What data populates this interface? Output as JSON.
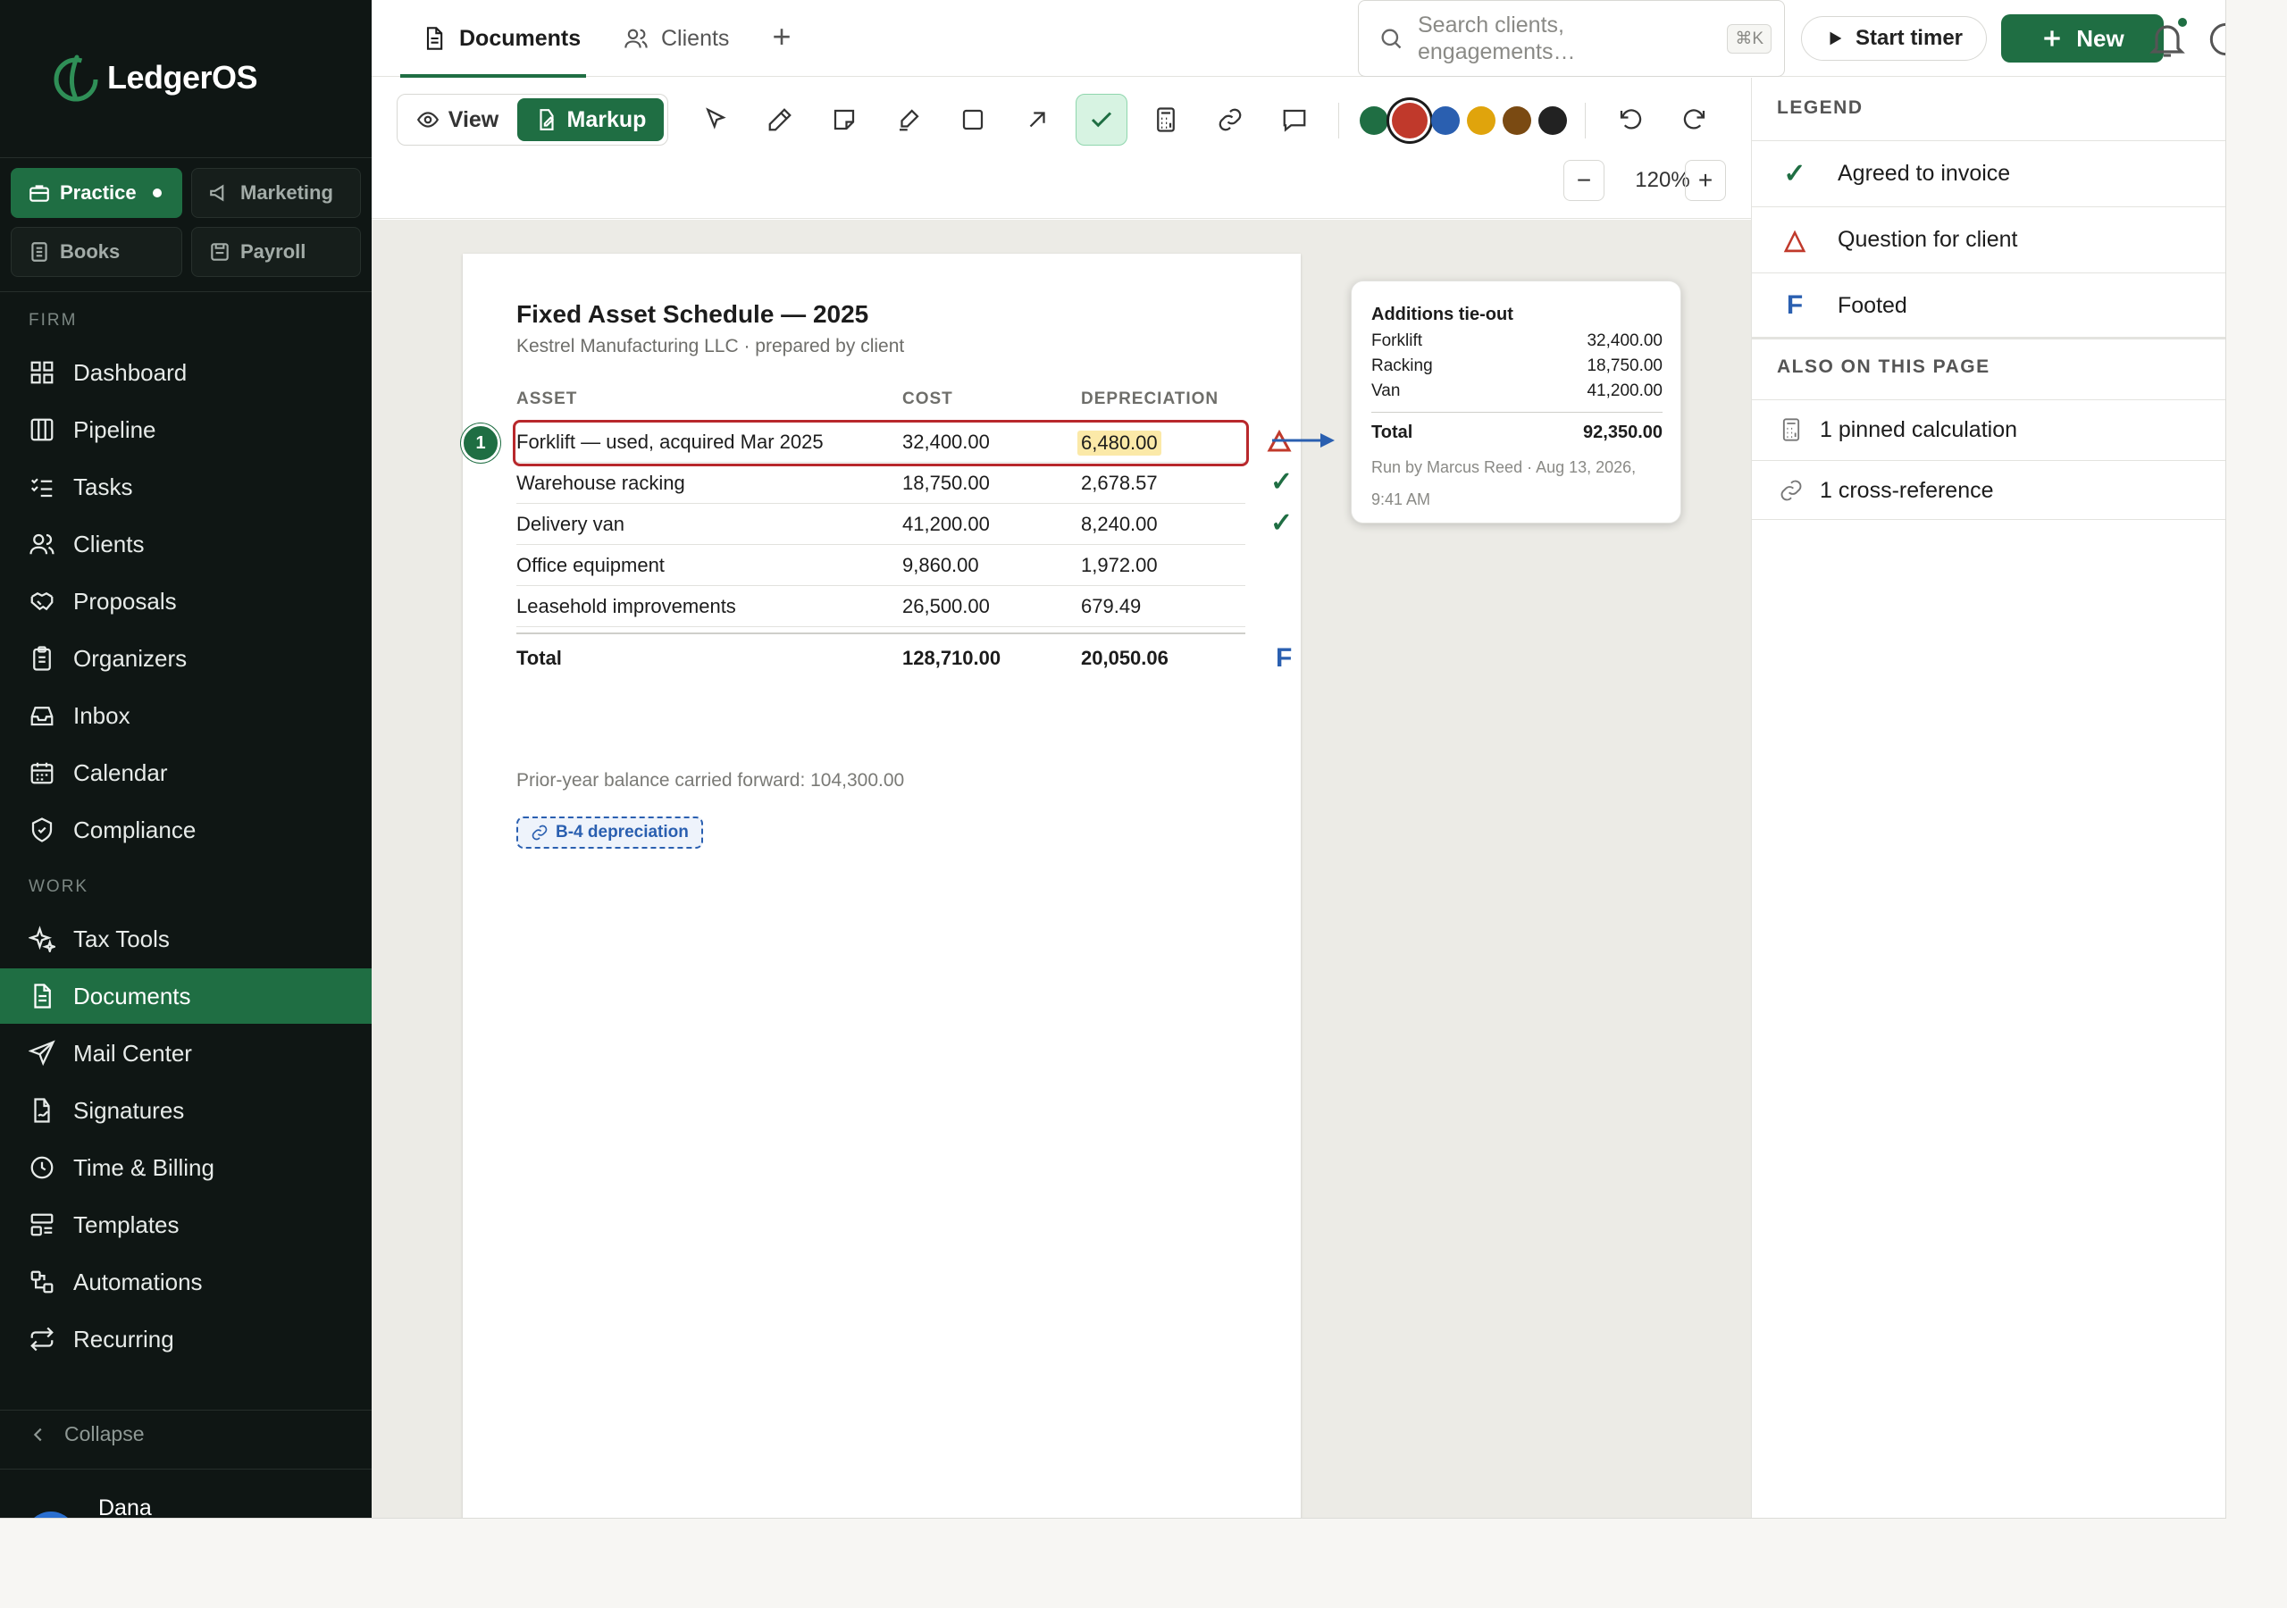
{
  "app": {
    "name": "LedgerOS"
  },
  "workspaces": [
    {
      "label": "Practice",
      "active": true,
      "icon": "briefcase-icon"
    },
    {
      "label": "Marketing",
      "active": false,
      "icon": "megaphone-icon"
    },
    {
      "label": "Books",
      "active": false,
      "icon": "ledger-icon"
    },
    {
      "label": "Payroll",
      "active": false,
      "icon": "payroll-icon"
    }
  ],
  "sidebar": {
    "firm_label": "FIRM",
    "work_label": "WORK",
    "firm_items": [
      {
        "label": "Dashboard",
        "icon": "grid-icon"
      },
      {
        "label": "Pipeline",
        "icon": "columns-icon"
      },
      {
        "label": "Tasks",
        "icon": "checklist-icon"
      },
      {
        "label": "Clients",
        "icon": "users-icon"
      },
      {
        "label": "Proposals",
        "icon": "handshake-icon"
      },
      {
        "label": "Organizers",
        "icon": "clipboard-icon"
      },
      {
        "label": "Inbox",
        "icon": "inbox-icon"
      },
      {
        "label": "Calendar",
        "icon": "calendar-icon"
      },
      {
        "label": "Compliance",
        "icon": "shield-icon"
      }
    ],
    "work_items": [
      {
        "label": "Tax Tools",
        "icon": "sparkle-icon"
      },
      {
        "label": "Documents",
        "icon": "document-icon",
        "active": true
      },
      {
        "label": "Mail Center",
        "icon": "send-icon"
      },
      {
        "label": "Signatures",
        "icon": "signature-icon"
      },
      {
        "label": "Time & Billing",
        "icon": "clock-icon"
      },
      {
        "label": "Templates",
        "icon": "template-icon"
      },
      {
        "label": "Automations",
        "icon": "automation-icon"
      },
      {
        "label": "Recurring",
        "icon": "repeat-icon"
      }
    ],
    "collapse_label": "Collapse",
    "user_name": "Dana"
  },
  "topbar": {
    "tabs": [
      {
        "label": "Documents",
        "active": true,
        "icon": "document-icon"
      },
      {
        "label": "Clients",
        "active": false,
        "icon": "users-icon"
      }
    ],
    "search_placeholder": "Search clients, engagements…",
    "search_shortcut": "⌘K",
    "timer_label": "Start timer",
    "new_label": "New"
  },
  "toolbar": {
    "view_label": "View",
    "markup_label": "Markup",
    "tools": [
      "select-icon",
      "pen-icon",
      "sticky-note-icon",
      "highlighter-icon",
      "rectangle-icon",
      "arrow-icon",
      "tickmark-icon",
      "calculator-icon",
      "link-icon",
      "comment-icon"
    ],
    "active_tool": "tickmark-icon",
    "colors": [
      "#1f6e43",
      "#c0392b",
      "#2a5fb0",
      "#e0a40c",
      "#7a4a12",
      "#222222"
    ],
    "selected_color": "#c0392b",
    "zoom": "120%"
  },
  "document": {
    "title": "Fixed Asset Schedule — 2025",
    "subtitle": "Kestrel Manufacturing LLC · prepared by client",
    "columns": {
      "asset": "ASSET",
      "cost": "COST",
      "depreciation": "DEPRECIATION"
    },
    "rows": [
      {
        "asset": "Forklift — used, acquired Mar 2025",
        "cost": "32,400.00",
        "depreciation": "6,480.00",
        "mark": "question"
      },
      {
        "asset": "Warehouse racking",
        "cost": "18,750.00",
        "depreciation": "2,678.57",
        "mark": "check"
      },
      {
        "asset": "Delivery van",
        "cost": "41,200.00",
        "depreciation": "8,240.00",
        "mark": "check"
      },
      {
        "asset": "Office equipment",
        "cost": "9,860.00",
        "depreciation": "1,972.00",
        "mark": ""
      },
      {
        "asset": "Leasehold improvements",
        "cost": "26,500.00",
        "depreciation": "679.49",
        "mark": ""
      }
    ],
    "total": {
      "label": "Total",
      "cost": "128,710.00",
      "depreciation": "20,050.06",
      "mark": "F"
    },
    "pin_number": "1",
    "prior_note": "Prior-year balance carried forward: 104,300.00",
    "xref_label": "B-4 depreciation"
  },
  "calc_card": {
    "title": "Additions tie-out",
    "lines": [
      {
        "label": "Forklift",
        "value": "32,400.00"
      },
      {
        "label": "Racking",
        "value": "18,750.00"
      },
      {
        "label": "Van",
        "value": "41,200.00"
      }
    ],
    "total_label": "Total",
    "total_value": "92,350.00",
    "meta": "Run by Marcus Reed · Aug 13, 2026, 9:41 AM"
  },
  "legend": {
    "heading": "LEGEND",
    "items": [
      {
        "symbol": "✓",
        "label": "Agreed to invoice",
        "color": "#1f6e43"
      },
      {
        "symbol": "△",
        "label": "Question for client",
        "color": "#c0392b"
      },
      {
        "symbol": "F",
        "label": "Footed",
        "color": "#2a5fb0"
      }
    ],
    "also_heading": "ALSO ON THIS PAGE",
    "also_items": [
      {
        "label": "1 pinned calculation",
        "icon": "calculator-icon"
      },
      {
        "label": "1 cross-reference",
        "icon": "link-icon"
      }
    ]
  }
}
